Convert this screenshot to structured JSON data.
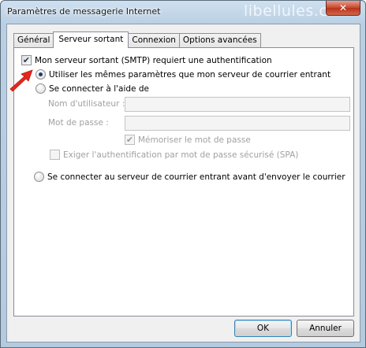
{
  "window": {
    "title": "Paramètres de messagerie Internet",
    "watermark": "libellules.ch",
    "close_glyph": "✕"
  },
  "tabs": [
    {
      "label": "Général"
    },
    {
      "label": "Serveur sortant",
      "active": true
    },
    {
      "label": "Connexion"
    },
    {
      "label": "Options avancées"
    }
  ],
  "outgoing": {
    "smtp_auth_label": "Mon serveur sortant (SMTP) requiert une authentification",
    "smtp_auth_checked": true,
    "use_same_label": "Utiliser les mêmes paramètres que mon serveur de courrier entrant",
    "use_same_selected": true,
    "login_with_label": "Se connecter à l'aide de",
    "username_label": "Nom d'utilisateur :",
    "username_value": "",
    "password_label": "Mot de passe :",
    "password_value": "",
    "remember_password_label": "Mémoriser le mot de passe",
    "remember_password_checked": true,
    "spa_label": "Exiger l'authentification par mot de passe sécurisé (SPA)",
    "spa_checked": false,
    "login_incoming_first_label": "Se connecter au serveur de courrier entrant avant d'envoyer le courrier"
  },
  "buttons": {
    "ok": "OK",
    "cancel": "Annuler"
  },
  "icons": {
    "check": "✔",
    "annotation_arrow": "red-arrow-icon"
  },
  "colors": {
    "arrow": "#e8261c",
    "title_bar": "#b9cfe3",
    "close_button": "#c9452c"
  }
}
